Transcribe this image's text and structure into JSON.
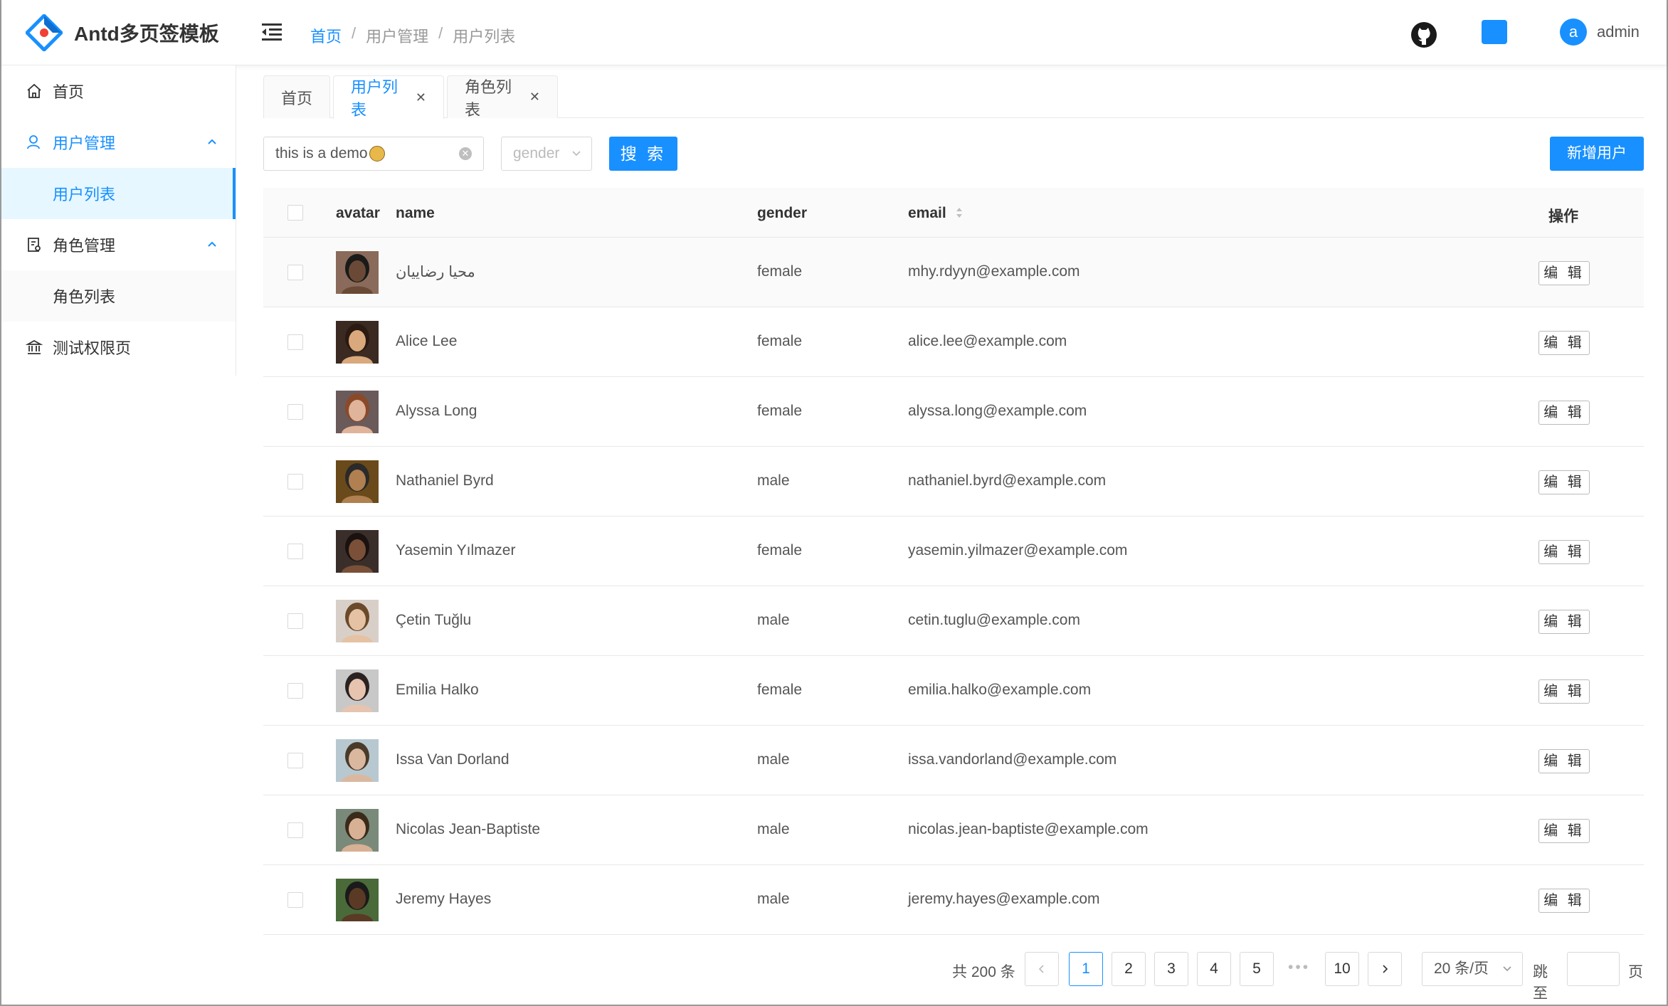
{
  "header": {
    "logo_text": "Antd多页签模板",
    "breadcrumb": [
      "首页",
      "用户管理",
      "用户列表"
    ],
    "breadcrumb_sep": "/",
    "user_initial": "a",
    "user_name": "admin"
  },
  "sidebar": {
    "items": [
      {
        "label": "首页",
        "icon": "home-icon"
      },
      {
        "label": "用户管理",
        "icon": "user-icon",
        "open": true,
        "children": [
          {
            "label": "用户列表",
            "selected": true
          }
        ]
      },
      {
        "label": "角色管理",
        "icon": "role-icon",
        "open": true,
        "children": [
          {
            "label": "角色列表"
          }
        ]
      },
      {
        "label": "测试权限页",
        "icon": "bank-icon"
      }
    ]
  },
  "tabs": [
    {
      "label": "首页",
      "closable": false
    },
    {
      "label": "用户列表",
      "closable": true,
      "active": true
    },
    {
      "label": "角色列表",
      "closable": true
    }
  ],
  "toolbar": {
    "search_value": "this is a demo",
    "gender_placeholder": "gender",
    "search_button": "搜 索",
    "add_button": "新增用户"
  },
  "table": {
    "columns": [
      "avatar",
      "name",
      "gender",
      "email",
      "操作"
    ],
    "edit_label": "编 辑",
    "rows": [
      {
        "name": "محیا رضاییان",
        "gender": "female",
        "email": "mhy.rdyyn@example.com",
        "skin": "#6a4a36",
        "hair": "#1a1a1a",
        "bg": "#8a6a5a"
      },
      {
        "name": "Alice Lee",
        "gender": "female",
        "email": "alice.lee@example.com",
        "skin": "#d9a87c",
        "hair": "#2a1a12",
        "bg": "#3a2a22"
      },
      {
        "name": "Alyssa Long",
        "gender": "female",
        "email": "alyssa.long@example.com",
        "skin": "#e0b49a",
        "hair": "#8a4a2a",
        "bg": "#6a5a5a"
      },
      {
        "name": "Nathaniel Byrd",
        "gender": "male",
        "email": "nathaniel.byrd@example.com",
        "skin": "#b08050",
        "hair": "#2a2a2a",
        "bg": "#6a4a1a"
      },
      {
        "name": "Yasemin Yılmazer",
        "gender": "female",
        "email": "yasemin.yilmazer@example.com",
        "skin": "#7a5038",
        "hair": "#1a1210",
        "bg": "#3a2e2a"
      },
      {
        "name": "Çetin Tuğlu",
        "gender": "male",
        "email": "cetin.tuglu@example.com",
        "skin": "#e6c2a4",
        "hair": "#6a4a2a",
        "bg": "#d8d0c8"
      },
      {
        "name": "Emilia Halko",
        "gender": "female",
        "email": "emilia.halko@example.com",
        "skin": "#e6c4b0",
        "hair": "#2a2220",
        "bg": "#c8c8c8"
      },
      {
        "name": "Issa Van Dorland",
        "gender": "male",
        "email": "issa.vandorland@example.com",
        "skin": "#dab8a0",
        "hair": "#4a3a2a",
        "bg": "#b8c8d0"
      },
      {
        "name": "Nicolas Jean-Baptiste",
        "gender": "male",
        "email": "nicolas.jean-baptiste@example.com",
        "skin": "#d8b094",
        "hair": "#3a2a1a",
        "bg": "#7a8a7a"
      },
      {
        "name": "Jeremy Hayes",
        "gender": "male",
        "email": "jeremy.hayes@example.com",
        "skin": "#5a3a24",
        "hair": "#1a1a1a",
        "bg": "#4a6a3a"
      }
    ]
  },
  "pagination": {
    "total_text": "共 200 条",
    "pages": [
      "1",
      "2",
      "3",
      "4",
      "5",
      "10"
    ],
    "current": "1",
    "ellipsis": "•••",
    "page_size": "20 条/页",
    "jump_label": "跳至",
    "page_suffix": "页"
  },
  "colors": {
    "primary": "#1890ff"
  }
}
